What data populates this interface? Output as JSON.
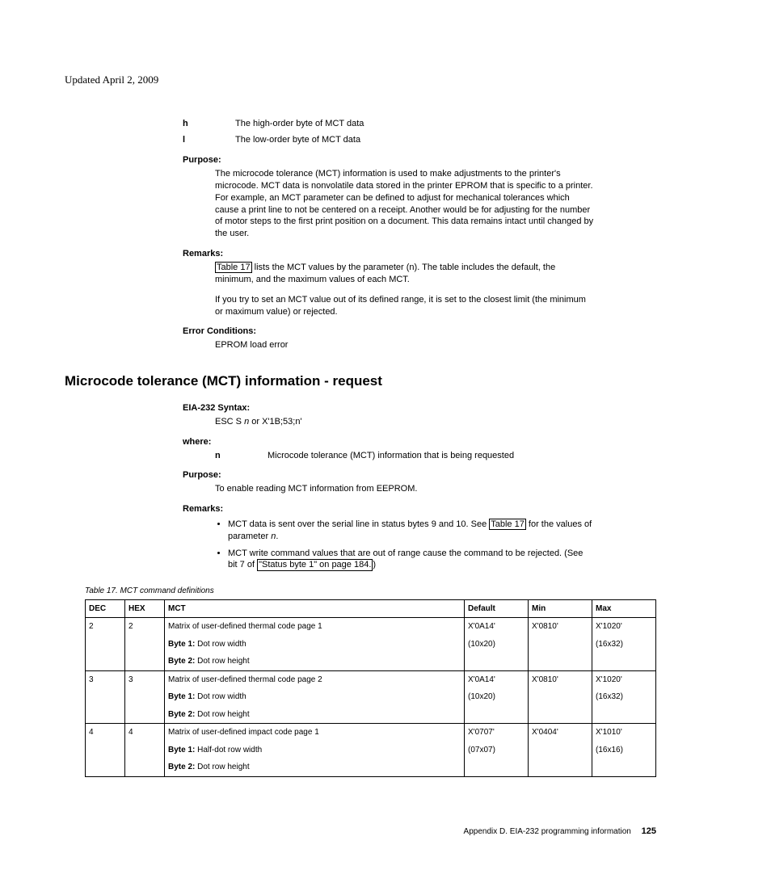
{
  "header": {
    "updated": "Updated April 2, 2009"
  },
  "defs": {
    "h": {
      "key": "h",
      "text": "The high-order byte of MCT data"
    },
    "l": {
      "key": "l",
      "text": "The low-order byte of MCT data"
    }
  },
  "sec1": {
    "purpose_label": "Purpose:",
    "purpose_text": "The microcode tolerance (MCT) information is used to make adjustments to the printer's microcode. MCT data is nonvolatile data stored in the printer EPROM that is specific to a printer. For example, an MCT parameter can be defined to adjust for mechanical tolerances which cause a print line to not be centered on a receipt. Another would be for adjusting for the number of motor steps to the first print position on a document. This data remains intact until changed by the user.",
    "remarks_label": "Remarks:",
    "remarks_link": "Table 17",
    "remarks_text1a": " lists the MCT values by the parameter (n). The table includes the default, the minimum, and the maximum values of each MCT.",
    "remarks_text2": "If you try to set an MCT value out of its defined range, it is set to the closest limit (the minimum or maximum value) or rejected.",
    "error_label": "Error Conditions:",
    "error_text": "EPROM load error"
  },
  "sec2": {
    "heading": "Microcode tolerance (MCT) information - request",
    "syntax_label": "EIA-232 Syntax:",
    "syntax_prefix": "ESC S ",
    "syntax_n": "n",
    "syntax_suffix": " or X'1B;53;n'",
    "where_label": "where:",
    "n_key": "n",
    "n_text": "Microcode tolerance (MCT) information that is being requested",
    "purpose_label": "Purpose:",
    "purpose_text": "To enable reading MCT information from EEPROM.",
    "remarks_label": "Remarks:",
    "bullet1_a": "MCT data is sent over the serial line in status bytes 9 and 10. See ",
    "bullet1_link": "Table 17",
    "bullet1_b": " for the values of parameter ",
    "bullet1_n": "n",
    "bullet1_c": ".",
    "bullet2_a": "MCT write command values that are out of range cause the command to be rejected. (See bit 7 of ",
    "bullet2_link": "\"Status byte 1\" on page 184.",
    "bullet2_b": ")"
  },
  "table": {
    "caption": "Table 17. MCT command definitions",
    "headers": {
      "dec": "DEC",
      "hex": "HEX",
      "mct": "MCT",
      "default": "Default",
      "min": "Min",
      "max": "Max"
    },
    "rows": [
      {
        "dec": "2",
        "hex": "2",
        "mct_title": "Matrix of user-defined thermal code page 1",
        "b1_label": "Byte 1:",
        "b1_val": "  Dot row width",
        "b2_label": "Byte 2:",
        "b2_val": "  Dot row height",
        "def1": "X'0A14'",
        "def2": "(10x20)",
        "min": "X'0810'",
        "max1": "X'1020'",
        "max2": "(16x32)"
      },
      {
        "dec": "3",
        "hex": "3",
        "mct_title": "Matrix of user-defined thermal code page 2",
        "b1_label": "Byte 1:",
        "b1_val": "  Dot row width",
        "b2_label": "Byte 2:",
        "b2_val": "  Dot row height",
        "def1": "X'0A14'",
        "def2": "(10x20)",
        "min": "X'0810'",
        "max1": "X'1020'",
        "max2": "(16x32)"
      },
      {
        "dec": "4",
        "hex": "4",
        "mct_title": "Matrix of user-defined impact code page 1",
        "b1_label": "Byte 1:",
        "b1_val": "  Half-dot row width",
        "b2_label": "Byte 2:",
        "b2_val": "  Dot row height",
        "def1": "X'0707'",
        "def2": "(07x07)",
        "min": "X'0404'",
        "max1": "X'1010'",
        "max2": "(16x16)"
      }
    ]
  },
  "footer": {
    "text": "Appendix D. EIA-232 programming information",
    "page": "125"
  }
}
